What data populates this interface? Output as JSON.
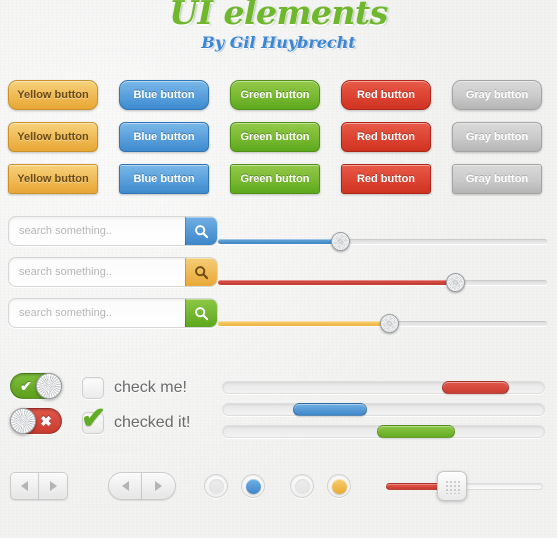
{
  "header": {
    "title": "UI elements",
    "subtitle": "By Gil Huybrecht",
    "title_color": "#6fb82e",
    "subtitle_color": "#3d86d4"
  },
  "buttons": {
    "rows": [
      {
        "corner": "rounded"
      },
      {
        "corner": "semi-rounded"
      },
      {
        "corner": "square"
      }
    ],
    "labels": {
      "yellow": "Yellow button",
      "blue": "Blue button",
      "green": "Green button",
      "red": "Red button",
      "gray": "Gray button"
    },
    "colors": {
      "yellow": "#eeb44c",
      "blue": "#4f97d6",
      "green": "#79ba32",
      "red": "#da4435",
      "gray": "#c8c8c8"
    }
  },
  "search": {
    "placeholder": "search something..",
    "value": "",
    "icon": "search-icon",
    "fields": [
      {
        "button_color": "blue"
      },
      {
        "button_color": "yellow"
      },
      {
        "button_color": "green"
      }
    ]
  },
  "sliders": [
    {
      "color": "blue",
      "value": 37,
      "hex": "#4f97d6"
    },
    {
      "color": "red",
      "value": 72,
      "hex": "#cc4238"
    },
    {
      "color": "yellow",
      "value": 52,
      "hex": "#f0bf56"
    }
  ],
  "toggles": [
    {
      "state": "on",
      "glyph": "✔",
      "color": "#6bae2c"
    },
    {
      "state": "off",
      "glyph": "✖",
      "color": "#d44a3e"
    }
  ],
  "checkboxes": [
    {
      "label": "check me!",
      "checked": false,
      "tick": ""
    },
    {
      "label": "checked it!",
      "checked": true,
      "tick": "✔"
    }
  ],
  "scrollbars": [
    {
      "color": "red",
      "start": 68,
      "end": 89,
      "hex": "#d6493d"
    },
    {
      "color": "blue",
      "start": 22,
      "end": 45,
      "hex": "#4f97d6"
    },
    {
      "color": "green",
      "start": 48,
      "end": 72,
      "hex": "#79ba32"
    }
  ],
  "pagers": [
    {
      "shape": "rect",
      "prev": "prev-arrow",
      "next": "next-arrow"
    },
    {
      "shape": "pill",
      "prev": "prev-arrow",
      "next": "next-arrow"
    }
  ],
  "radios": [
    {
      "state": "empty",
      "color": "#ededed"
    },
    {
      "state": "selected",
      "color": "#4f97d6"
    },
    {
      "state": "empty",
      "color": "#ededed"
    },
    {
      "state": "selected",
      "color": "#eeb44c"
    }
  ],
  "handle_slider": {
    "color": "red",
    "hex": "#d6493d",
    "value": 42,
    "handle": "grip-handle"
  }
}
